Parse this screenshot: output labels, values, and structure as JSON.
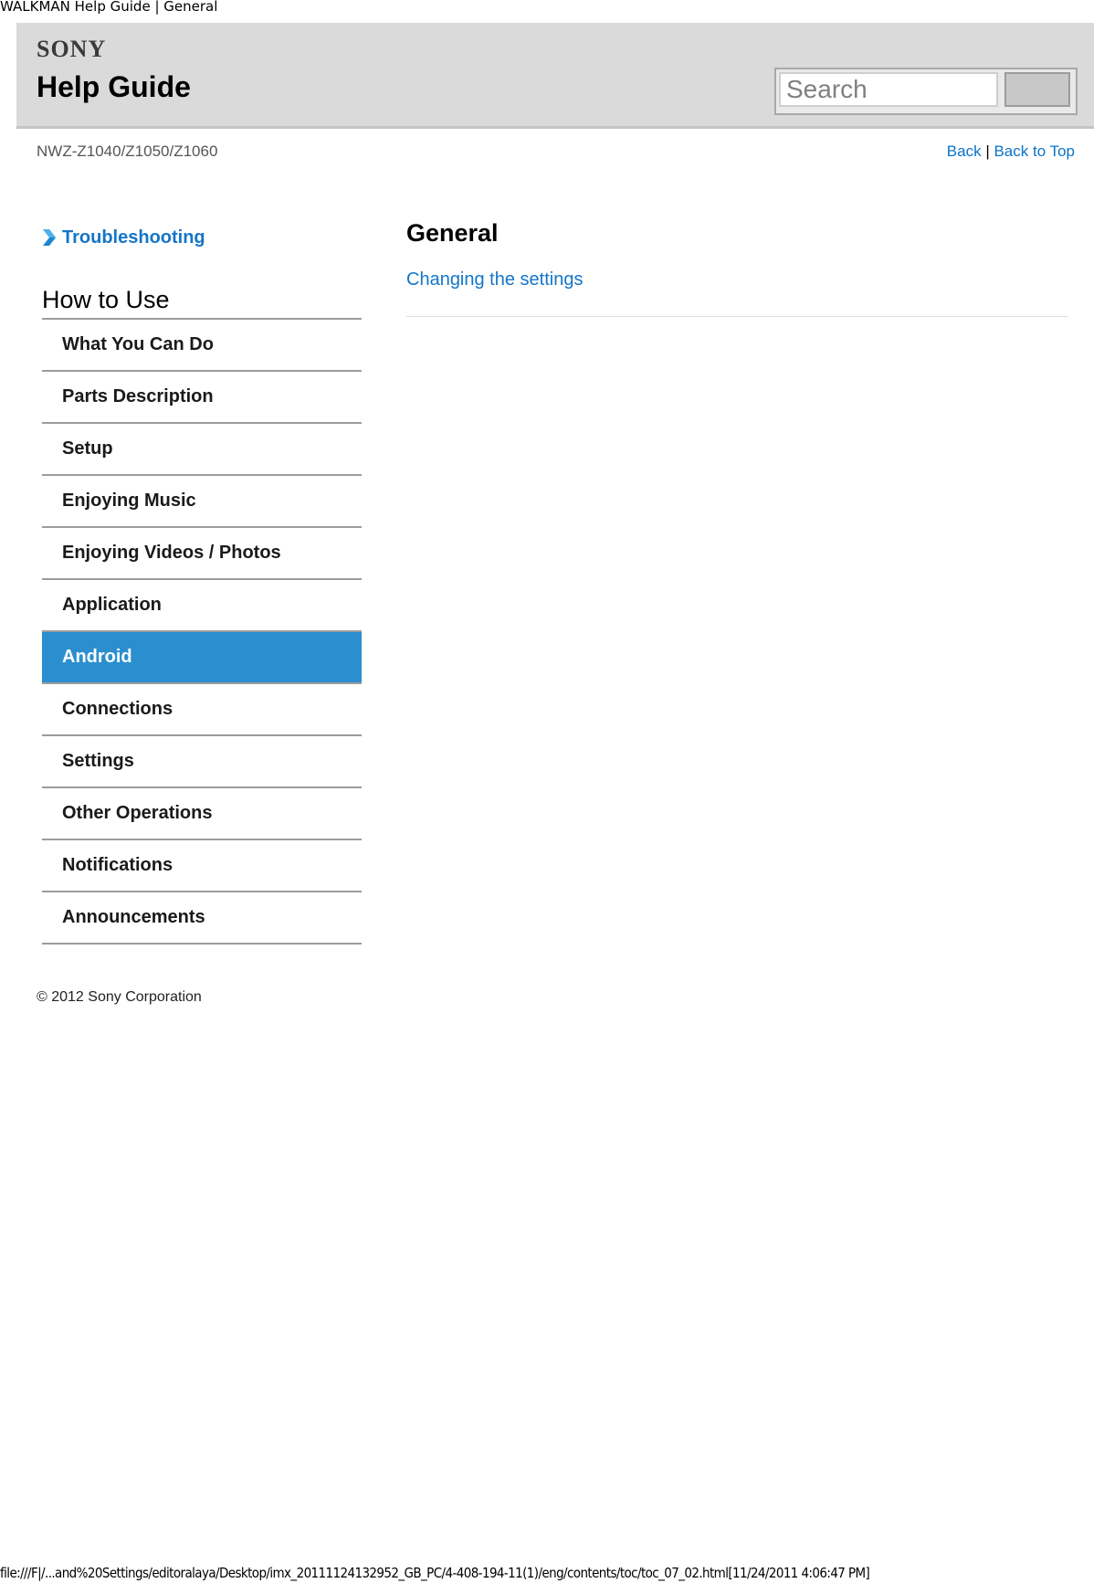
{
  "window_title": "WALKMAN Help Guide | General",
  "header": {
    "logo": "SONY",
    "title": "Help Guide",
    "search_placeholder": "Search",
    "search_button_label": ""
  },
  "subheader": {
    "model": "NWZ-Z1040/Z1050/Z1060",
    "back_label": "Back",
    "separator": "|",
    "back_to_top_label": "Back to Top"
  },
  "sidebar": {
    "troubleshooting_label": "Troubleshooting",
    "how_to_use_heading": "How to Use",
    "items": [
      {
        "label": "What You Can Do",
        "active": false
      },
      {
        "label": "Parts Description",
        "active": false
      },
      {
        "label": "Setup",
        "active": false
      },
      {
        "label": "Enjoying Music",
        "active": false
      },
      {
        "label": "Enjoying Videos / Photos",
        "active": false
      },
      {
        "label": "Application",
        "active": false
      },
      {
        "label": "Android",
        "active": true
      },
      {
        "label": "Connections",
        "active": false
      },
      {
        "label": "Settings",
        "active": false
      },
      {
        "label": "Other Operations",
        "active": false
      },
      {
        "label": "Notifications",
        "active": false
      },
      {
        "label": "Announcements",
        "active": false
      }
    ],
    "copyright": "© 2012 Sony Corporation"
  },
  "main": {
    "heading": "General",
    "links": [
      "Changing the settings"
    ]
  },
  "colors": {
    "link": "#1475c8",
    "active_bg": "#2b8fcf",
    "header_bg": "#dadada"
  },
  "footer_path": "file:///F|/...and%20Settings/editoralaya/Desktop/imx_20111124132952_GB_PC/4-408-194-11(1)/eng/contents/toc/toc_07_02.html[11/24/2011 4:06:47 PM]"
}
